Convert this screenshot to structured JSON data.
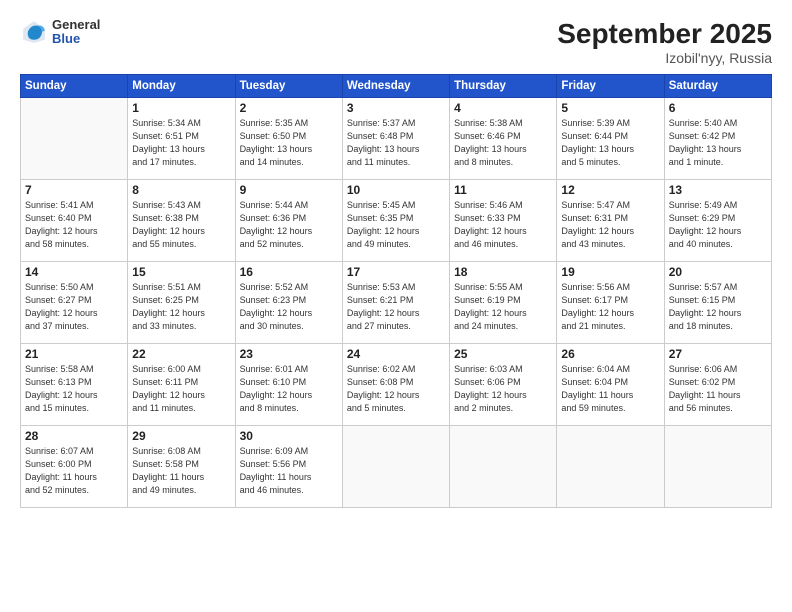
{
  "header": {
    "logo": {
      "general": "General",
      "blue": "Blue"
    },
    "title": "September 2025",
    "location": "Izobil'nyy, Russia"
  },
  "weekdays": [
    "Sunday",
    "Monday",
    "Tuesday",
    "Wednesday",
    "Thursday",
    "Friday",
    "Saturday"
  ],
  "weeks": [
    [
      {
        "day": "",
        "info": ""
      },
      {
        "day": "1",
        "info": "Sunrise: 5:34 AM\nSunset: 6:51 PM\nDaylight: 13 hours\nand 17 minutes."
      },
      {
        "day": "2",
        "info": "Sunrise: 5:35 AM\nSunset: 6:50 PM\nDaylight: 13 hours\nand 14 minutes."
      },
      {
        "day": "3",
        "info": "Sunrise: 5:37 AM\nSunset: 6:48 PM\nDaylight: 13 hours\nand 11 minutes."
      },
      {
        "day": "4",
        "info": "Sunrise: 5:38 AM\nSunset: 6:46 PM\nDaylight: 13 hours\nand 8 minutes."
      },
      {
        "day": "5",
        "info": "Sunrise: 5:39 AM\nSunset: 6:44 PM\nDaylight: 13 hours\nand 5 minutes."
      },
      {
        "day": "6",
        "info": "Sunrise: 5:40 AM\nSunset: 6:42 PM\nDaylight: 13 hours\nand 1 minute."
      }
    ],
    [
      {
        "day": "7",
        "info": "Sunrise: 5:41 AM\nSunset: 6:40 PM\nDaylight: 12 hours\nand 58 minutes."
      },
      {
        "day": "8",
        "info": "Sunrise: 5:43 AM\nSunset: 6:38 PM\nDaylight: 12 hours\nand 55 minutes."
      },
      {
        "day": "9",
        "info": "Sunrise: 5:44 AM\nSunset: 6:36 PM\nDaylight: 12 hours\nand 52 minutes."
      },
      {
        "day": "10",
        "info": "Sunrise: 5:45 AM\nSunset: 6:35 PM\nDaylight: 12 hours\nand 49 minutes."
      },
      {
        "day": "11",
        "info": "Sunrise: 5:46 AM\nSunset: 6:33 PM\nDaylight: 12 hours\nand 46 minutes."
      },
      {
        "day": "12",
        "info": "Sunrise: 5:47 AM\nSunset: 6:31 PM\nDaylight: 12 hours\nand 43 minutes."
      },
      {
        "day": "13",
        "info": "Sunrise: 5:49 AM\nSunset: 6:29 PM\nDaylight: 12 hours\nand 40 minutes."
      }
    ],
    [
      {
        "day": "14",
        "info": "Sunrise: 5:50 AM\nSunset: 6:27 PM\nDaylight: 12 hours\nand 37 minutes."
      },
      {
        "day": "15",
        "info": "Sunrise: 5:51 AM\nSunset: 6:25 PM\nDaylight: 12 hours\nand 33 minutes."
      },
      {
        "day": "16",
        "info": "Sunrise: 5:52 AM\nSunset: 6:23 PM\nDaylight: 12 hours\nand 30 minutes."
      },
      {
        "day": "17",
        "info": "Sunrise: 5:53 AM\nSunset: 6:21 PM\nDaylight: 12 hours\nand 27 minutes."
      },
      {
        "day": "18",
        "info": "Sunrise: 5:55 AM\nSunset: 6:19 PM\nDaylight: 12 hours\nand 24 minutes."
      },
      {
        "day": "19",
        "info": "Sunrise: 5:56 AM\nSunset: 6:17 PM\nDaylight: 12 hours\nand 21 minutes."
      },
      {
        "day": "20",
        "info": "Sunrise: 5:57 AM\nSunset: 6:15 PM\nDaylight: 12 hours\nand 18 minutes."
      }
    ],
    [
      {
        "day": "21",
        "info": "Sunrise: 5:58 AM\nSunset: 6:13 PM\nDaylight: 12 hours\nand 15 minutes."
      },
      {
        "day": "22",
        "info": "Sunrise: 6:00 AM\nSunset: 6:11 PM\nDaylight: 12 hours\nand 11 minutes."
      },
      {
        "day": "23",
        "info": "Sunrise: 6:01 AM\nSunset: 6:10 PM\nDaylight: 12 hours\nand 8 minutes."
      },
      {
        "day": "24",
        "info": "Sunrise: 6:02 AM\nSunset: 6:08 PM\nDaylight: 12 hours\nand 5 minutes."
      },
      {
        "day": "25",
        "info": "Sunrise: 6:03 AM\nSunset: 6:06 PM\nDaylight: 12 hours\nand 2 minutes."
      },
      {
        "day": "26",
        "info": "Sunrise: 6:04 AM\nSunset: 6:04 PM\nDaylight: 11 hours\nand 59 minutes."
      },
      {
        "day": "27",
        "info": "Sunrise: 6:06 AM\nSunset: 6:02 PM\nDaylight: 11 hours\nand 56 minutes."
      }
    ],
    [
      {
        "day": "28",
        "info": "Sunrise: 6:07 AM\nSunset: 6:00 PM\nDaylight: 11 hours\nand 52 minutes."
      },
      {
        "day": "29",
        "info": "Sunrise: 6:08 AM\nSunset: 5:58 PM\nDaylight: 11 hours\nand 49 minutes."
      },
      {
        "day": "30",
        "info": "Sunrise: 6:09 AM\nSunset: 5:56 PM\nDaylight: 11 hours\nand 46 minutes."
      },
      {
        "day": "",
        "info": ""
      },
      {
        "day": "",
        "info": ""
      },
      {
        "day": "",
        "info": ""
      },
      {
        "day": "",
        "info": ""
      }
    ]
  ]
}
